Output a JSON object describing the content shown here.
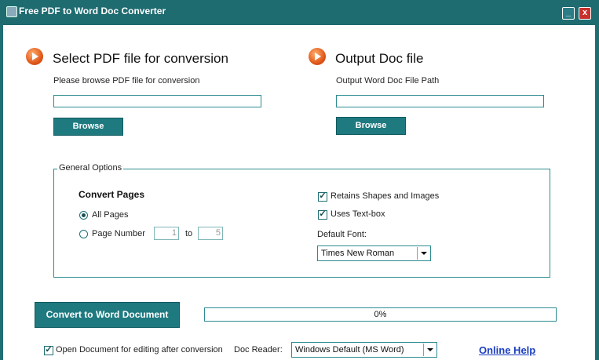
{
  "window": {
    "title": "Free PDF to Word Doc Converter",
    "minimize_label": "_",
    "close_label": "x"
  },
  "input_section": {
    "title": "Select PDF file for conversion",
    "hint": "Please browse PDF file for conversion",
    "path_value": "",
    "browse_label": "Browse"
  },
  "output_section": {
    "title": "Output Doc file",
    "hint": "Output Word Doc File Path",
    "path_value": "",
    "browse_label": "Browse"
  },
  "options": {
    "legend": "General Options",
    "convert_pages_label": "Convert Pages",
    "all_pages_label": "All Pages",
    "all_pages_selected": true,
    "page_number_label": "Page Number",
    "page_number_selected": false,
    "page_from": "1",
    "to_label": "to",
    "page_to": "5",
    "retain_shapes_label": "Retains Shapes and Images",
    "retain_shapes_checked": true,
    "textbox_label": "Uses Text-box",
    "textbox_checked": true,
    "default_font_label": "Default Font:",
    "default_font_value": "Times New Roman"
  },
  "footer": {
    "convert_label": "Convert to Word Document",
    "progress_text": "0%",
    "progress_value": 0,
    "open_after_label": "Open Document for editing after conversion",
    "open_after_checked": true,
    "doc_reader_label": "Doc Reader:",
    "doc_reader_value": "Windows Default (MS Word)",
    "help_link": "Online Help"
  },
  "checkmark": "✓",
  "accent_color": "#1f6e74"
}
